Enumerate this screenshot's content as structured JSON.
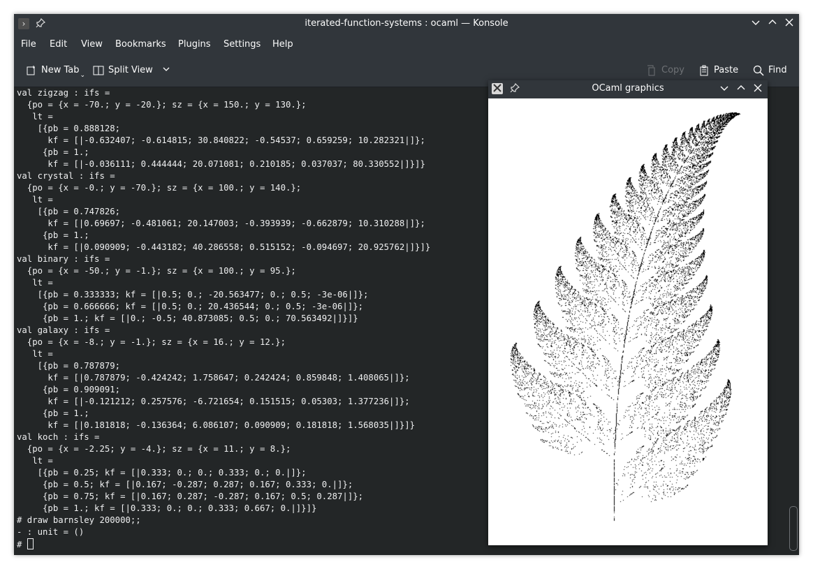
{
  "window": {
    "title": "iterated-function-systems : ocaml — Konsole",
    "menu": [
      "File",
      "Edit",
      "View",
      "Bookmarks",
      "Plugins",
      "Settings",
      "Help"
    ],
    "toolbar": {
      "new_tab": "New Tab",
      "split_view": "Split View",
      "copy": "Copy",
      "paste": "Paste",
      "find": "Find"
    }
  },
  "terminal": {
    "lines": [
      "val zigzag : ifs =",
      "  {po = {x = -70.; y = -20.}; sz = {x = 150.; y = 130.};",
      "   lt =",
      "    [{pb = 0.888128;",
      "      kf = [|-0.632407; -0.614815; 30.840822; -0.54537; 0.659259; 10.282321|]};",
      "     {pb = 1.;",
      "      kf = [|-0.036111; 0.444444; 20.071081; 0.210185; 0.037037; 80.330552|]}]}",
      "val crystal : ifs =",
      "  {po = {x = -0.; y = -70.}; sz = {x = 100.; y = 140.};",
      "   lt =",
      "    [{pb = 0.747826;",
      "      kf = [|0.69697; -0.481061; 20.147003; -0.393939; -0.662879; 10.310288|]};",
      "     {pb = 1.;",
      "      kf = [|0.090909; -0.443182; 40.286558; 0.515152; -0.094697; 20.925762|]}]}",
      "val binary : ifs =",
      "  {po = {x = -50.; y = -1.}; sz = {x = 100.; y = 95.};",
      "   lt =",
      "    [{pb = 0.333333; kf = [|0.5; 0.; -20.563477; 0.; 0.5; -3e-06|]};",
      "     {pb = 0.666666; kf = [|0.5; 0.; 20.436544; 0.; 0.5; -3e-06|]};",
      "     {pb = 1.; kf = [|0.; -0.5; 40.873085; 0.5; 0.; 70.563492|]}]}",
      "val galaxy : ifs =",
      "  {po = {x = -8.; y = -1.}; sz = {x = 16.; y = 12.};",
      "   lt =",
      "    [{pb = 0.787879;",
      "      kf = [|0.787879; -0.424242; 1.758647; 0.242424; 0.859848; 1.408065|]};",
      "     {pb = 0.909091;",
      "      kf = [|-0.121212; 0.257576; -6.721654; 0.151515; 0.05303; 1.377236|]};",
      "     {pb = 1.;",
      "      kf = [|0.181818; -0.136364; 6.086107; 0.090909; 0.181818; 1.568035|]}]}",
      "val koch : ifs =",
      "  {po = {x = -2.25; y = -4.}; sz = {x = 11.; y = 8.};",
      "   lt =",
      "    [{pb = 0.25; kf = [|0.333; 0.; 0.; 0.333; 0.; 0.|]};",
      "     {pb = 0.5; kf = [|0.167; -0.287; 0.287; 0.167; 0.333; 0.|]};",
      "     {pb = 0.75; kf = [|0.167; 0.287; -0.287; 0.167; 0.5; 0.287|]};",
      "     {pb = 1.; kf = [|0.333; 0.; 0.; 0.333; 0.667; 0.|]}]}",
      "# draw barnsley 200000;;",
      "- : unit = ()"
    ],
    "prompt": "# "
  },
  "graphics_window": {
    "title": "OCaml graphics"
  }
}
